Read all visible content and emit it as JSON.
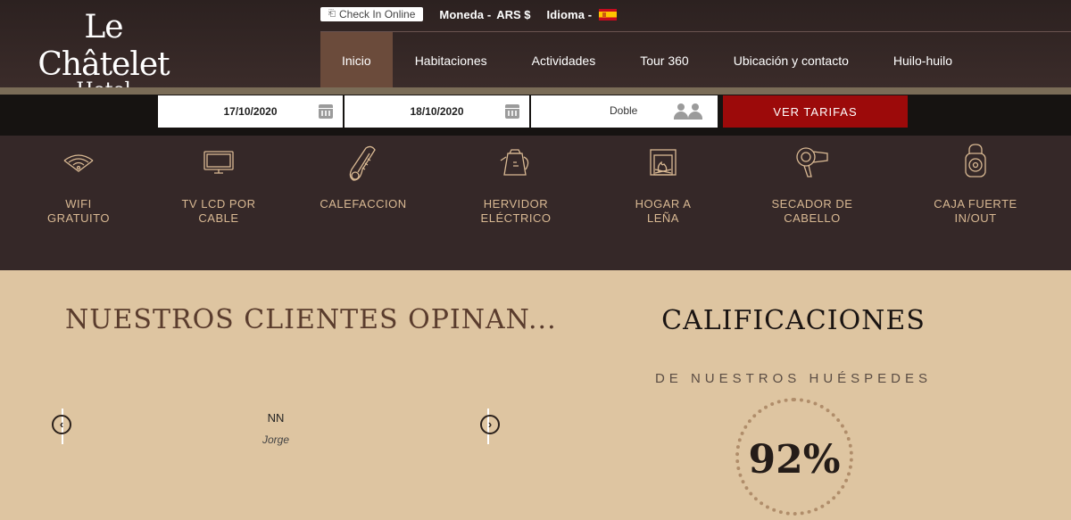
{
  "header": {
    "logo_name": "Le Châtelet",
    "logo_sub": "Hotel",
    "checkin_label": "Check In Online",
    "currency_label": "Moneda -",
    "currency_value": "ARS $",
    "language_label": "Idioma -",
    "nav": [
      {
        "label": "Inicio",
        "active": true
      },
      {
        "label": "Habitaciones"
      },
      {
        "label": "Actividades"
      },
      {
        "label": "Tour 360"
      },
      {
        "label": "Ubicación y contacto"
      },
      {
        "label": "Huilo-huilo"
      }
    ]
  },
  "booking": {
    "checkin_date": "17/10/2020",
    "checkout_date": "18/10/2020",
    "room_type": "Doble",
    "submit_label": "VER TARIFAS"
  },
  "amenities": [
    {
      "label": "WIFI\nGRATUITO",
      "icon": "wifi-icon"
    },
    {
      "label": "TV LCD POR\nCABLE",
      "icon": "tv-icon"
    },
    {
      "label": "CALEFACCION",
      "icon": "thermometer-icon"
    },
    {
      "label": "HERVIDOR\nELÉCTRICO",
      "icon": "kettle-icon"
    },
    {
      "label": "HOGAR A\nLEÑA",
      "icon": "fireplace-icon"
    },
    {
      "label": "SECADOR DE\nCABELLO",
      "icon": "hairdryer-icon"
    },
    {
      "label": "CAJA FUERTE\nIN/OUT",
      "icon": "safe-icon"
    }
  ],
  "reviews": {
    "title": "NUESTROS CLIENTES OPINAN...",
    "text": "NN",
    "author": "Jorge"
  },
  "ratings": {
    "title": "CALIFICACIONES",
    "subtitle": "DE NUESTROS HUÉSPEDES",
    "score": "92%"
  },
  "colors": {
    "header_bg": "#2c2120",
    "nav_active": "#6b4b3b",
    "amenities_bg": "#352828",
    "amenity_text": "#d9b993",
    "cta_red": "#9c0a0a",
    "page_bg": "#dec5a1"
  }
}
